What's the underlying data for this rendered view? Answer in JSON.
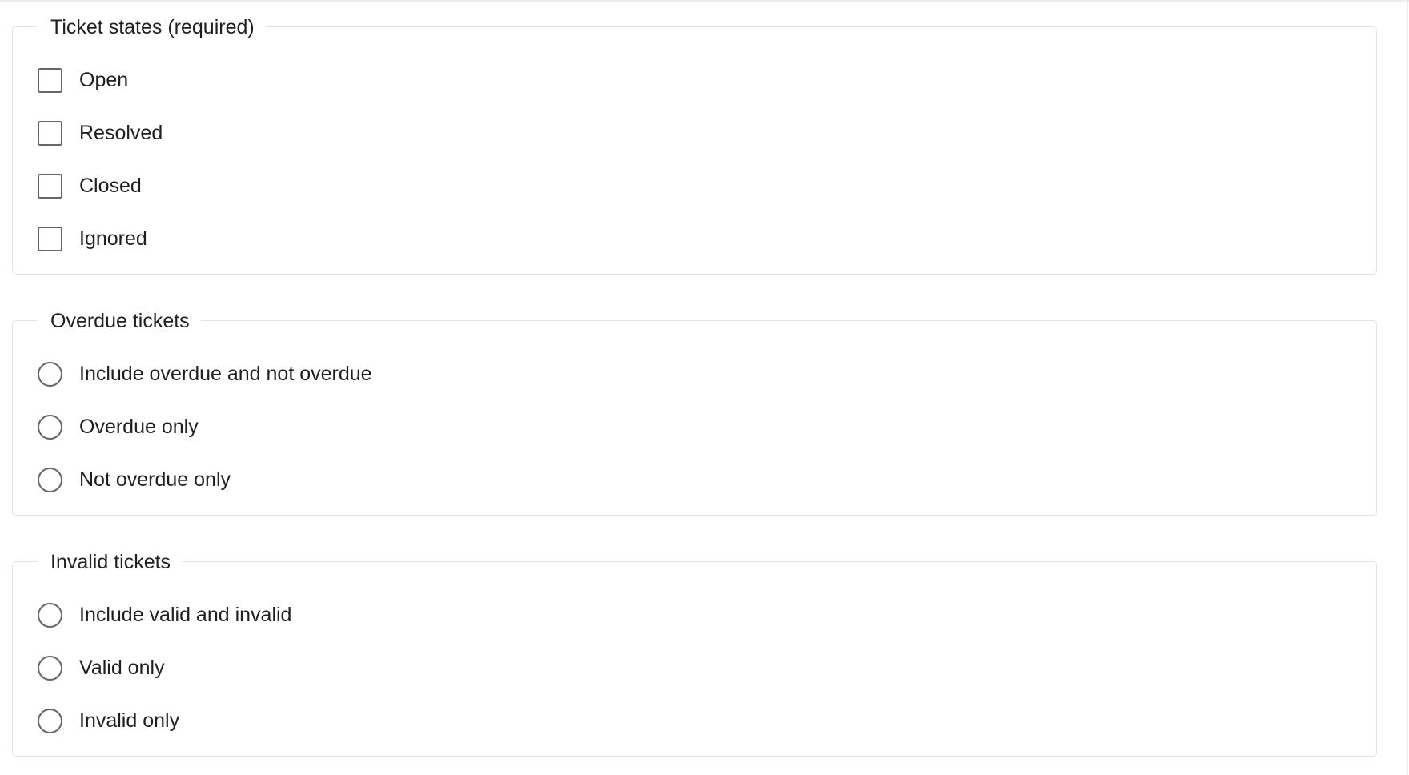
{
  "sections": [
    {
      "legend": "Ticket states (required)",
      "type": "checkbox",
      "options": [
        {
          "label": "Open",
          "checked": false
        },
        {
          "label": "Resolved",
          "checked": false
        },
        {
          "label": "Closed",
          "checked": false
        },
        {
          "label": "Ignored",
          "checked": false
        }
      ]
    },
    {
      "legend": "Overdue tickets",
      "type": "radio",
      "options": [
        {
          "label": "Include overdue and not overdue",
          "checked": false
        },
        {
          "label": "Overdue only",
          "checked": false
        },
        {
          "label": "Not overdue only",
          "checked": false
        }
      ]
    },
    {
      "legend": "Invalid tickets",
      "type": "radio",
      "options": [
        {
          "label": "Include valid and invalid",
          "checked": false
        },
        {
          "label": "Valid only",
          "checked": false
        },
        {
          "label": "Invalid only",
          "checked": false
        }
      ]
    }
  ]
}
